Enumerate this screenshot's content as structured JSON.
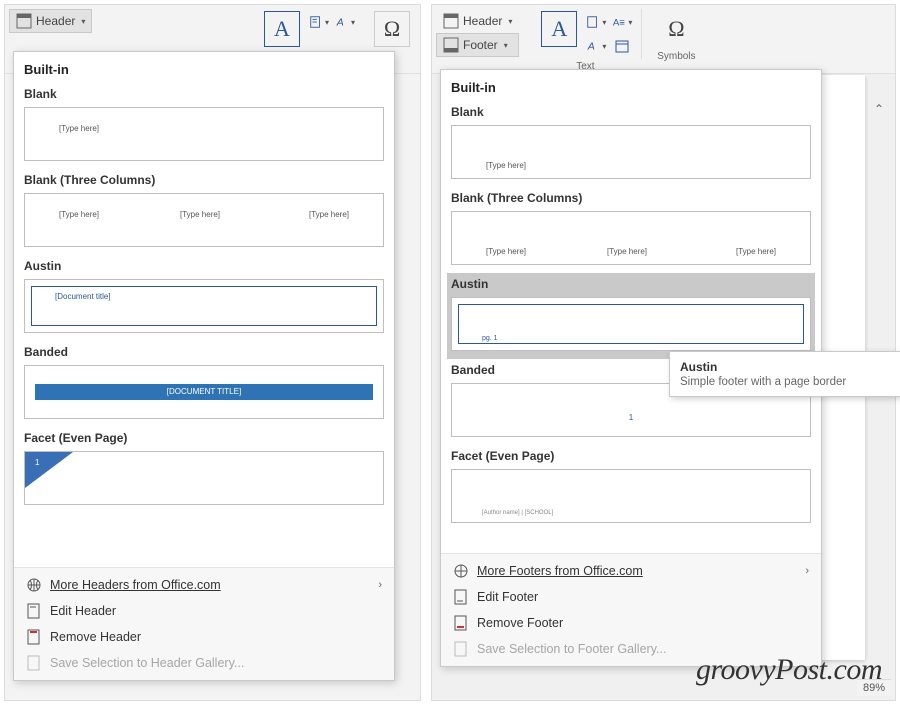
{
  "watermark": "groovyPost.com",
  "left": {
    "ribbon": {
      "header_btn": "Header",
      "textbox_glyph": "A",
      "symbol_glyph": "Ω"
    },
    "gallery": {
      "section": "Built-in",
      "items": [
        {
          "label": "Blank",
          "ph": [
            "[Type here]"
          ]
        },
        {
          "label": "Blank (Three Columns)",
          "ph": [
            "[Type here]",
            "[Type here]",
            "[Type here]"
          ]
        },
        {
          "label": "Austin",
          "ph": [
            "[Document title]"
          ]
        },
        {
          "label": "Banded",
          "ph": [
            "[DOCUMENT TITLE]"
          ]
        },
        {
          "label": "Facet (Even Page)",
          "ph": [
            "1"
          ]
        }
      ],
      "footer": {
        "more": "More Headers from Office.com",
        "edit": "Edit Header",
        "remove": "Remove Header",
        "save": "Save Selection to Header Gallery..."
      }
    }
  },
  "right": {
    "zoom": "89%",
    "ribbon": {
      "header_btn": "Header",
      "footer_btn": "Footer",
      "textbox_glyph": "A",
      "text_label": "Text",
      "symbol_glyph": "Ω",
      "symbols_label": "Symbols"
    },
    "tooltip": {
      "title": "Austin",
      "desc": "Simple footer with a page border"
    },
    "gallery": {
      "section": "Built-in",
      "items": [
        {
          "label": "Blank",
          "ph": [
            "[Type here]"
          ]
        },
        {
          "label": "Blank (Three Columns)",
          "ph": [
            "[Type here]",
            "[Type here]",
            "[Type here]"
          ]
        },
        {
          "label": "Austin",
          "ph": [
            "pg. 1"
          ]
        },
        {
          "label": "Banded",
          "ph": [
            "1"
          ]
        },
        {
          "label": "Facet (Even Page)",
          "ph": [
            "[Author name] | [SCHOOL]"
          ]
        }
      ],
      "footer": {
        "more": "More Footers from Office.com",
        "edit": "Edit Footer",
        "remove": "Remove Footer",
        "save": "Save Selection to Footer Gallery..."
      }
    }
  }
}
